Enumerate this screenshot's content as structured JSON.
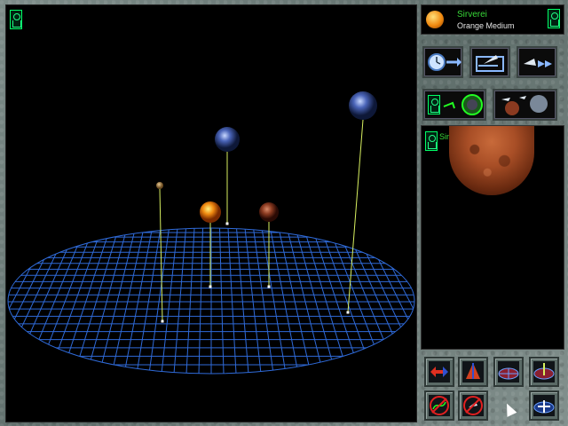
{
  "star": {
    "name": "Sirverei",
    "class": "Orange Medium"
  },
  "planet_view": {
    "name": "Sirverei I"
  },
  "colors": {
    "grid": "#2f6ad8",
    "label_green": "#38d838",
    "stem": "#d8f060"
  },
  "icons": {
    "time_advance": "clock-arrow-icon",
    "launch": "launch-bay-icon",
    "fleet_forward": "ship-fast-forward-icon",
    "transfer": "ship-transfer-icon",
    "planets_overview": "planets-overview-icon"
  }
}
